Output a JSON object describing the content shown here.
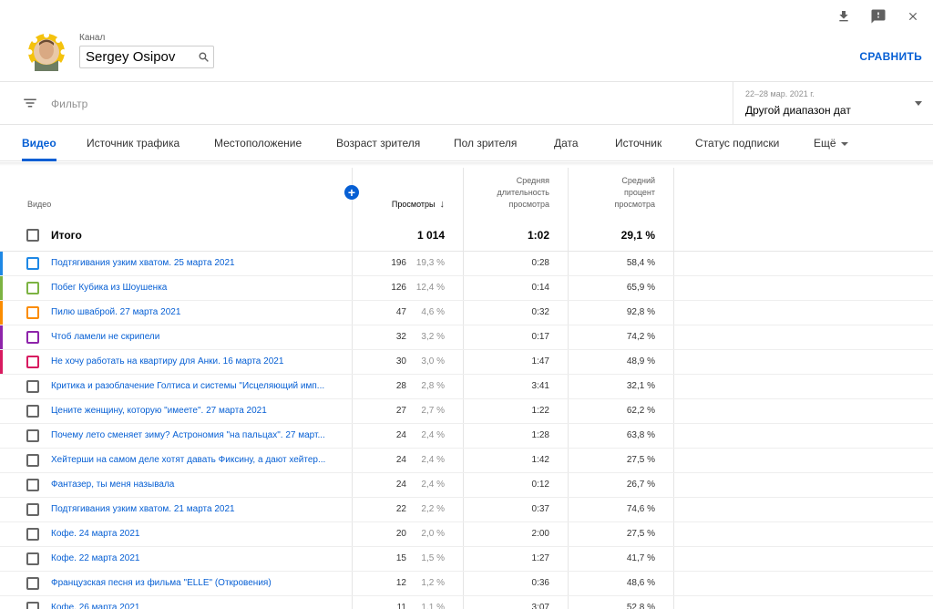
{
  "header": {
    "channel_label": "Канал",
    "channel_name": "Sergey Osipov",
    "compare": "СРАВНИТЬ"
  },
  "filter": {
    "label": "Фильтр",
    "date_sub": "22–28 мар. 2021 г.",
    "date_main": "Другой диапазон дат"
  },
  "tabs": [
    "Видео",
    "Источник трафика",
    "Местоположение",
    "Возраст зрителя",
    "Пол зрителя",
    "Дата",
    "Источник",
    "Статус подписки",
    "Ещё"
  ],
  "table": {
    "headers": {
      "video": "Видео",
      "views": "Просмотры",
      "duration": "Средняя длительность просмотра",
      "avg_pct": "Средний процент просмотра"
    },
    "total": {
      "label": "Итого",
      "views": "1 014",
      "duration": "1:02",
      "avg_pct": "29,1 %"
    },
    "rows": [
      {
        "title": "Подтягивания узким хватом. 25 марта 2021",
        "views": "196",
        "share": "19,3 %",
        "duration": "0:28",
        "avg_pct": "58,4 %",
        "color": "#1e88e5"
      },
      {
        "title": "Побег Кубика из Шоушенка",
        "views": "126",
        "share": "12,4 %",
        "duration": "0:14",
        "avg_pct": "65,9 %",
        "color": "#7cb342"
      },
      {
        "title": "Пилю шваброй. 27 марта 2021",
        "views": "47",
        "share": "4,6 %",
        "duration": "0:32",
        "avg_pct": "92,8 %",
        "color": "#fb8c00"
      },
      {
        "title": "Чтоб ламели не скрипели",
        "views": "32",
        "share": "3,2 %",
        "duration": "0:17",
        "avg_pct": "74,2 %",
        "color": "#8e24aa"
      },
      {
        "title": "Не хочу работать на квартиру для Анки. 16 марта 2021",
        "views": "30",
        "share": "3,0 %",
        "duration": "1:47",
        "avg_pct": "48,9 %",
        "color": "#d81b60"
      },
      {
        "title": "Критика и разоблачение Голтиса и системы \"Исцеляющий имп...",
        "views": "28",
        "share": "2,8 %",
        "duration": "3:41",
        "avg_pct": "32,1 %",
        "color": ""
      },
      {
        "title": "Цените женщину, которую \"имеете\". 27 марта 2021",
        "views": "27",
        "share": "2,7 %",
        "duration": "1:22",
        "avg_pct": "62,2 %",
        "color": ""
      },
      {
        "title": "Почему лето сменяет зиму? Астрономия \"на пальцах\". 27 март...",
        "views": "24",
        "share": "2,4 %",
        "duration": "1:28",
        "avg_pct": "63,8 %",
        "color": ""
      },
      {
        "title": "Хейтерши на самом деле хотят давать Фиксину, а дают хейтер...",
        "views": "24",
        "share": "2,4 %",
        "duration": "1:42",
        "avg_pct": "27,5 %",
        "color": ""
      },
      {
        "title": "Фантазер, ты меня называла",
        "views": "24",
        "share": "2,4 %",
        "duration": "0:12",
        "avg_pct": "26,7 %",
        "color": ""
      },
      {
        "title": "Подтягивания узким хватом. 21 марта 2021",
        "views": "22",
        "share": "2,2 %",
        "duration": "0:37",
        "avg_pct": "74,6 %",
        "color": ""
      },
      {
        "title": "Кофе. 24 марта 2021",
        "views": "20",
        "share": "2,0 %",
        "duration": "2:00",
        "avg_pct": "27,5 %",
        "color": ""
      },
      {
        "title": "Кофе. 22 марта 2021",
        "views": "15",
        "share": "1,5 %",
        "duration": "1:27",
        "avg_pct": "41,7 %",
        "color": ""
      },
      {
        "title": "Французская песня из фильма \"ELLE\" (Откровения)",
        "views": "12",
        "share": "1,2 %",
        "duration": "0:36",
        "avg_pct": "48,6 %",
        "color": ""
      },
      {
        "title": "Кофе. 26 марта 2021",
        "views": "11",
        "share": "1,1 %",
        "duration": "3:07",
        "avg_pct": "52,8 %",
        "color": ""
      }
    ]
  }
}
